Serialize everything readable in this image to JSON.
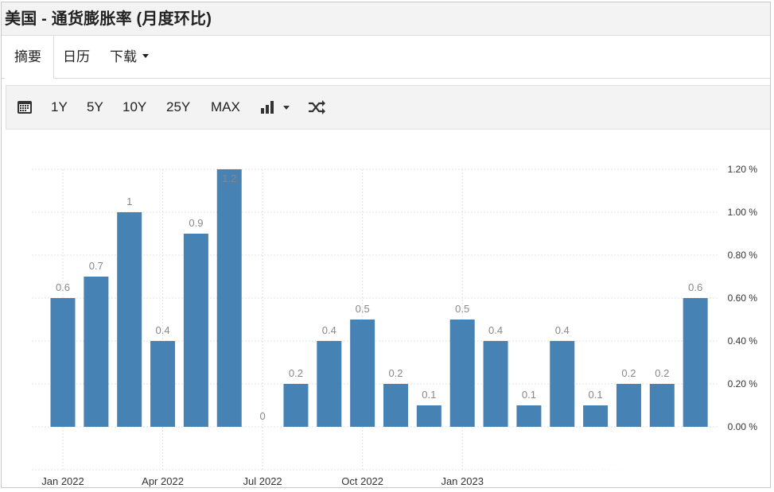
{
  "title": "美国 - 通货膨胀率 (月度环比)",
  "tabs": [
    {
      "label": "摘要"
    },
    {
      "label": "日历"
    },
    {
      "label": "下载"
    }
  ],
  "toolbar": {
    "ranges": [
      "1Y",
      "5Y",
      "10Y",
      "25Y",
      "MAX"
    ]
  },
  "colors": {
    "bar": "#4682b4",
    "grid": "#e0e0e0",
    "label": "#888888",
    "axis_text": "#333333"
  },
  "chart_data": {
    "type": "bar",
    "title": "",
    "xlabel": "",
    "ylabel": "",
    "ylim": [
      -0.2,
      1.2
    ],
    "y_ticks": [
      0.0,
      0.2,
      0.4,
      0.6,
      0.8,
      1.0,
      1.2
    ],
    "y_tick_labels": [
      "0.00 %",
      "0.20 %",
      "0.40 %",
      "0.60 %",
      "0.80 %",
      "1.00 %",
      "1.20 %"
    ],
    "y_axis_side": "right",
    "x_tick_labels": [
      "Jan 2022",
      "Apr 2022",
      "Jul 2022",
      "Oct 2022",
      "Jan 2023"
    ],
    "x_tick_months": [
      "2022-01",
      "2022-04",
      "2022-07",
      "2022-10",
      "2023-01"
    ],
    "categories": [
      "2022-01",
      "2022-02",
      "2022-03",
      "2022-04",
      "2022-05",
      "2022-06",
      "2022-07",
      "2022-08",
      "2022-09",
      "2022-10",
      "2022-11",
      "2022-12",
      "2023-01",
      "2023-02",
      "2023-03",
      "2023-04",
      "2023-05",
      "2023-06",
      "2023-07",
      "2023-08"
    ],
    "values": [
      0.6,
      0.7,
      1.0,
      0.4,
      0.9,
      1.2,
      0.0,
      0.2,
      0.4,
      0.5,
      0.2,
      0.1,
      0.5,
      0.4,
      0.1,
      0.4,
      0.1,
      0.2,
      0.2,
      0.6
    ],
    "data_labels": [
      "0.6",
      "0.7",
      "1",
      "0.4",
      "0.9",
      "1.2",
      "0",
      "0.2",
      "0.4",
      "0.5",
      "0.2",
      "0.1",
      "0.5",
      "0.4",
      "0.1",
      "0.4",
      "0.1",
      "0.2",
      "0.2",
      "0.6"
    ],
    "grid": true
  }
}
